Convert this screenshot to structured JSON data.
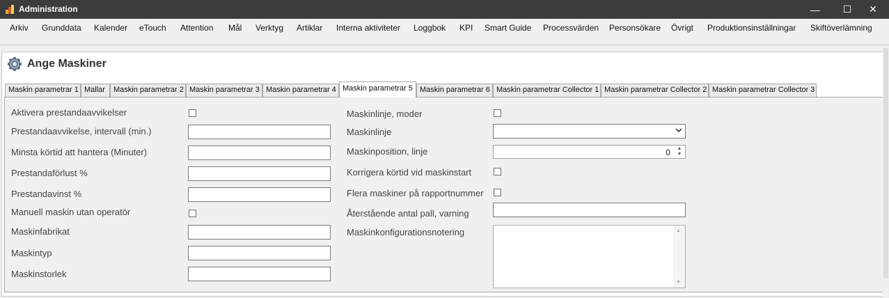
{
  "window": {
    "title": "Administration",
    "minimize_glyph": "—",
    "maximize_glyph": "☐",
    "close_glyph": "✕"
  },
  "menu": [
    "Arkiv",
    "Grunddata",
    "Kalender",
    "eTouch",
    "Attention",
    "Mål",
    "Verktyg",
    "Artiklar",
    "Interna aktiviteter",
    "Loggbok",
    "KPI",
    "Smart Guide",
    "Processvärden",
    "Personsökare",
    "Övrigt",
    "Produktionsinställningar",
    "Skiftöverlämning"
  ],
  "page": {
    "title": "Ange Maskiner",
    "icon": "gear-icon"
  },
  "tabs": [
    {
      "label": "Maskin parametrar 1",
      "active": false
    },
    {
      "label": "Mallar",
      "active": false
    },
    {
      "label": "Maskin parametrar 2",
      "active": false
    },
    {
      "label": "Maskin parametrar 3",
      "active": false
    },
    {
      "label": "Maskin parametrar 4",
      "active": false
    },
    {
      "label": "Maskin parametrar 5",
      "active": true
    },
    {
      "label": "Maskin parametrar 6",
      "active": false
    },
    {
      "label": "Maskin parametrar Collector 1",
      "active": false
    },
    {
      "label": "Maskin parametrar Collector 2",
      "active": false
    },
    {
      "label": "Maskin parametrar Collector 3",
      "active": false
    }
  ],
  "left_fields": [
    {
      "label": "Aktivera prestandaavvikelser",
      "type": "checkbox",
      "checked": false
    },
    {
      "label": "Prestandaavvikelse, intervall (min.)",
      "type": "text",
      "value": ""
    },
    {
      "label": "Minsta körtid att hantera (Minuter)",
      "type": "text",
      "value": ""
    },
    {
      "label": "Prestandaförlust %",
      "type": "text",
      "value": ""
    },
    {
      "label": "Prestandavinst %",
      "type": "text",
      "value": ""
    },
    {
      "label": "Manuell maskin utan operatör",
      "type": "checkbox",
      "checked": false
    },
    {
      "label": "Maskinfabrikat",
      "type": "text",
      "value": ""
    },
    {
      "label": "Maskintyp",
      "type": "text",
      "value": ""
    },
    {
      "label": "Maskinstorlek",
      "type": "text",
      "value": ""
    }
  ],
  "right_fields": [
    {
      "label": "Maskinlinje, moder",
      "type": "checkbox",
      "checked": false
    },
    {
      "label": "Maskinlinje",
      "type": "select",
      "value": ""
    },
    {
      "label": "Maskinposition, linje",
      "type": "spinner",
      "value": "0"
    },
    {
      "label": "Korrigera körtid vid maskinstart",
      "type": "checkbox",
      "checked": false
    },
    {
      "label": "Flera maskiner på rapportnummer",
      "type": "checkbox",
      "checked": false
    },
    {
      "label": "Återstående antal pall, varning",
      "type": "text",
      "value": ""
    },
    {
      "label": "Maskinkonfigurationsnotering",
      "type": "textarea",
      "value": ""
    }
  ],
  "colors": {
    "titlebar": "#3c3c3c",
    "accent_icon": "#e8a23a"
  }
}
